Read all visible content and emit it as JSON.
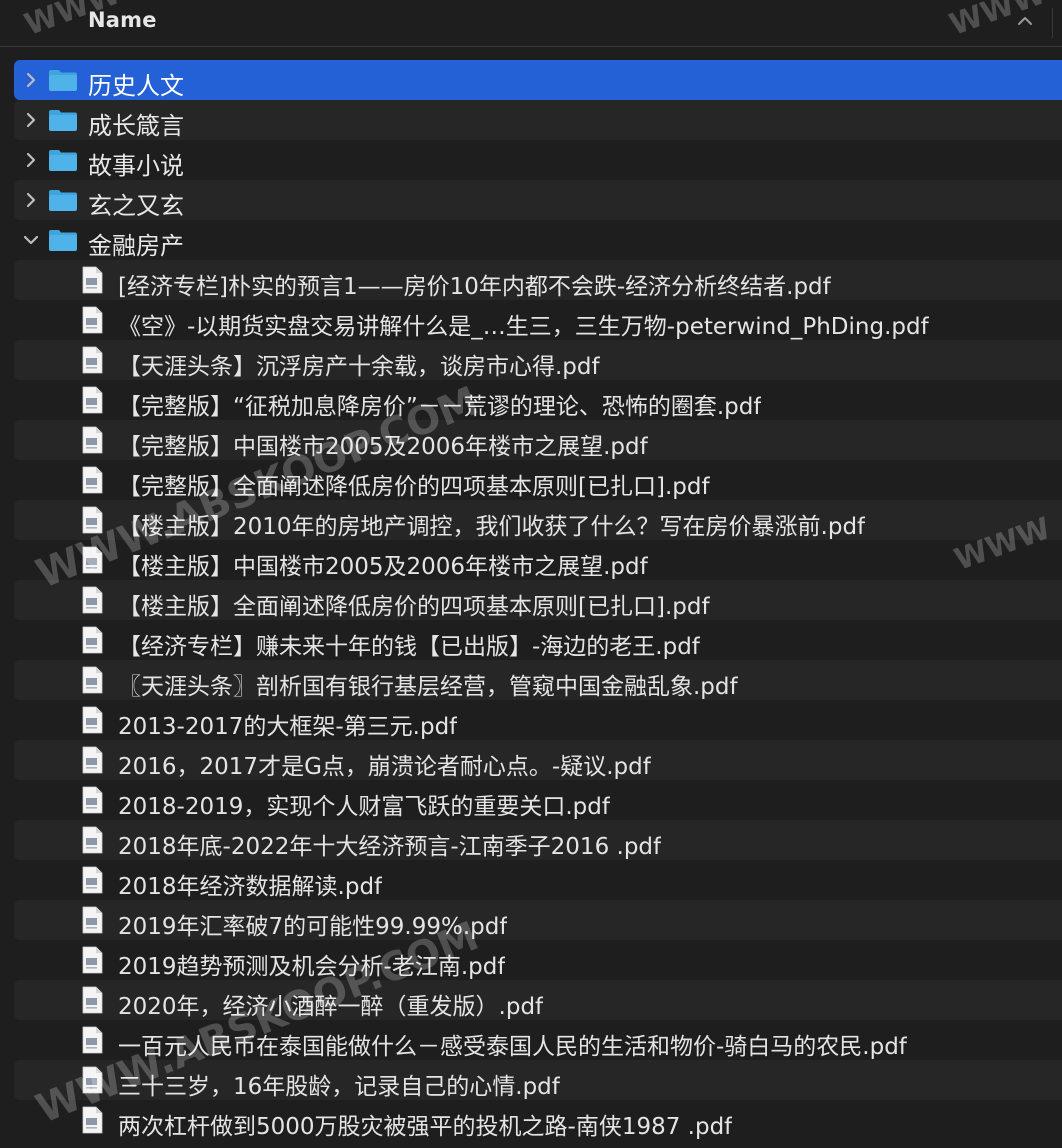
{
  "header": {
    "column_name": "Name",
    "sort_icon": "chevron-up-icon"
  },
  "folders_before": [
    {
      "label": "历史人文",
      "expanded": false,
      "selected": true
    },
    {
      "label": "成长箴言",
      "expanded": false,
      "selected": false
    },
    {
      "label": "故事小说",
      "expanded": false,
      "selected": false
    },
    {
      "label": "玄之又玄",
      "expanded": false,
      "selected": false
    },
    {
      "label": "金融房产",
      "expanded": true,
      "selected": false
    }
  ],
  "files": [
    "[经济专栏]朴实的预言1——房价10年内都不会跌-经济分析终结者.pdf",
    "《空》-以期货实盘交易讲解什么是_…生三，三生万物-peterwind_PhDing.pdf",
    "【天涯头条】沉浮房产十余载，谈房市心得.pdf",
    "【完整版】“征税加息降房价”－－荒谬的理论、恐怖的圈套.pdf",
    "【完整版】中国楼市2005及2006年楼市之展望.pdf",
    "【完整版】全面阐述降低房价的四项基本原则[已扎口].pdf",
    "【楼主版】2010年的房地产调控，我们收获了什么？写在房价暴涨前.pdf",
    "【楼主版】中国楼市2005及2006年楼市之展望.pdf",
    "【楼主版】全面阐述降低房价的四项基本原则[已扎口].pdf",
    "【经济专栏】赚未来十年的钱【已出版】-海边的老王.pdf",
    "〖天涯头条〗剖析国有银行基层经营，管窥中国金融乱象.pdf",
    "2013-2017的大框架-第三元.pdf",
    "2016，2017才是G点，崩溃论者耐心点。-疑议.pdf",
    "2018-2019，实现个人财富飞跃的重要关口.pdf",
    "2018年底-2022年十大经济预言-江南季子2016 .pdf",
    "2018年经济数据解读.pdf",
    "2019年汇率破7的可能性99.99%.pdf",
    "2019趋势预测及机会分析-老江南.pdf",
    "2020年，经济小酒醉一醉（重发版）.pdf",
    "一百元人民币在泰国能做什么－感受泰国人民的生活和物价-骑白马的农民.pdf",
    "三十三岁，16年股龄，记录自己的心情.pdf",
    "两次杠杆做到5000万股灾被强平的投机之路-南侠1987 .pdf"
  ],
  "watermark_text": "WWW.ABSKOOP.COM",
  "colors": {
    "background": "#1e1e1e",
    "alt_row": "#262626",
    "selection": "#2460d6",
    "folder_blue": "#4fb3ea"
  }
}
